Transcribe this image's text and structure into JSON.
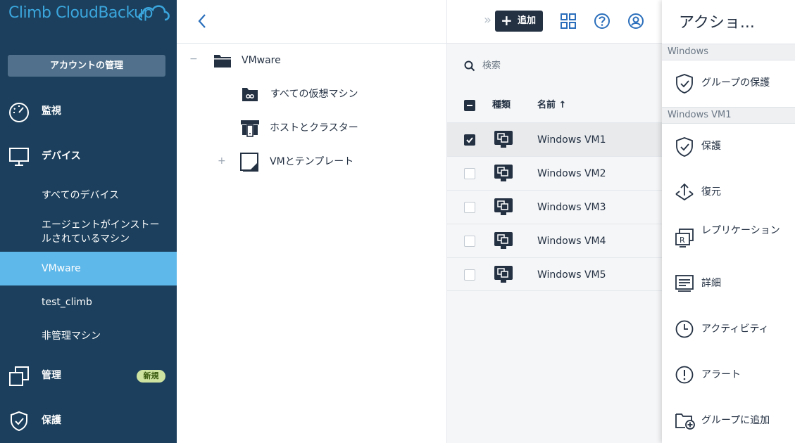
{
  "logo": {
    "text": "Climb CloudBackup"
  },
  "sidebar": {
    "account_button": "アカウントの管理",
    "monitor": "監視",
    "devices": "デバイス",
    "sub_items": [
      {
        "label": "すべてのデバイス"
      },
      {
        "label": "エージェントがインストールされているマシン"
      },
      {
        "label": "VMware"
      },
      {
        "label": "test_climb"
      },
      {
        "label": "非管理マシン"
      }
    ],
    "management": "管理",
    "new_badge": "新規",
    "protection": "保護"
  },
  "tree": {
    "root": {
      "label": "VMware",
      "toggle": "−"
    },
    "children": [
      {
        "label": "すべての仮想マシン"
      },
      {
        "label": "ホストとクラスター"
      },
      {
        "label": "VMとテンプレート",
        "toggle": "+"
      }
    ]
  },
  "toolbar": {
    "chevrons": "»",
    "add_label": "追加",
    "add_plus": "+"
  },
  "search": {
    "placeholder": "検索"
  },
  "list": {
    "columns": {
      "type": "種類",
      "name": "名前 ↑"
    },
    "rows": [
      {
        "name": "Windows VM1",
        "checked": true
      },
      {
        "name": "Windows VM2",
        "checked": false
      },
      {
        "name": "Windows VM3",
        "checked": false
      },
      {
        "name": "Windows VM4",
        "checked": false
      },
      {
        "name": "Windows VM5",
        "checked": false
      }
    ]
  },
  "actions": {
    "title": "アクショ...",
    "section_windows": "Windows",
    "group_protect": "グループの保護",
    "section_vm": "Windows VM1",
    "protect": "保護",
    "restore": "復元",
    "replication": "レプリケーション",
    "details": "詳細",
    "activity": "アクティビティ",
    "alert": "アラート",
    "add_to_group": "グループに追加"
  },
  "colors": {
    "sidebar_bg": "#1b3f5c",
    "active_item": "#5fb8ea",
    "accent_blue": "#2a6ebb",
    "dark": "#243143"
  }
}
